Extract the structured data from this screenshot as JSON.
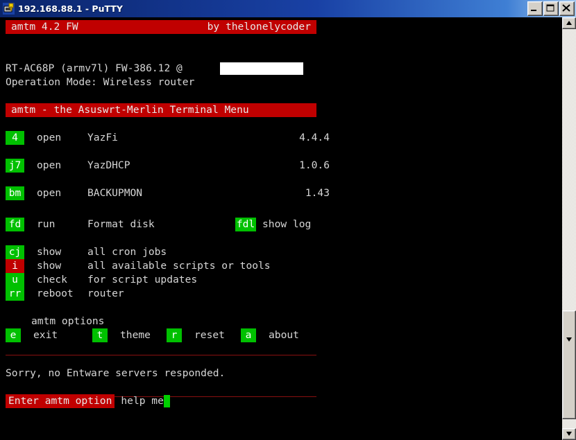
{
  "window": {
    "title": "192.168.88.1 - PuTTY",
    "icon": "putty-icon",
    "minimize_label": "_",
    "maximize_label": "□",
    "close_label": "✕"
  },
  "terminal": {
    "header_bar": {
      "left": "amtm 4.2 FW",
      "right": "by thelonelycoder"
    },
    "device_line": "RT-AC68P (armv7l) FW-386.12 @",
    "redacted_value": "",
    "mode_line": "Operation Mode: Wireless router",
    "menu_title": "amtm - the Asuswrt-Merlin Terminal Menu",
    "script_entries": [
      {
        "key": "4",
        "key_color": "#00c000",
        "action": "open",
        "name": "YazFi",
        "version": "4.4.4"
      },
      {
        "key": "j7",
        "key_color": "#00c000",
        "action": "open",
        "name": "YazDHCP",
        "version": "1.0.6"
      },
      {
        "key": "bm",
        "key_color": "#00c000",
        "action": "open",
        "name": "BACKUPMON",
        "version": "1.43"
      }
    ],
    "disk_entry": {
      "key": "fd",
      "action": "run",
      "name": "Format disk",
      "log_key": "fdl",
      "log_label": "show log"
    },
    "tool_entries": [
      {
        "key": "cj",
        "key_color": "#00c000",
        "action": "show",
        "description": "all cron jobs"
      },
      {
        "key": "i",
        "key_color": "#c00000",
        "action": "show",
        "description": "all available scripts or tools"
      },
      {
        "key": "u",
        "key_color": "#00c000",
        "action": "check",
        "description": "for script updates"
      },
      {
        "key": "rr",
        "key_color": "#00c000",
        "action": "reboot",
        "description": "router"
      }
    ],
    "options_title": "amtm options",
    "options": [
      {
        "key": "e",
        "label": "exit"
      },
      {
        "key": "t",
        "label": "theme"
      },
      {
        "key": "r",
        "label": "reset"
      },
      {
        "key": "a",
        "label": "about"
      }
    ],
    "status_message": "Sorry, no Entware servers responded.",
    "prompt": {
      "label": "Enter amtm option",
      "hint": "help me",
      "cursor": ""
    }
  },
  "scrollbar": {
    "up_arrow": "scroll-up-icon",
    "down_arrow": "scroll-down-icon"
  },
  "colors": {
    "accent_red": "#c00000",
    "accent_green": "#00c000",
    "terminal_bg": "#000000",
    "terminal_fg": "#d6d6d6",
    "divider": "#8a1010"
  }
}
